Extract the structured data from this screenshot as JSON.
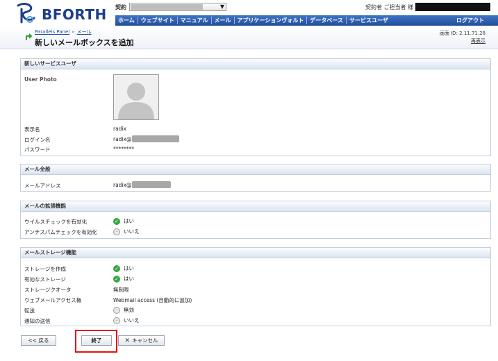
{
  "header": {
    "logo_text": "BFORTH",
    "contract_label": "契約",
    "user_label": "契約者 ご担当者 様",
    "nav": [
      "ホーム",
      "ウェブサイト",
      "マニュアル",
      "メール",
      "アプリケーションヴォルト",
      "データベース",
      "サービスユーザ"
    ],
    "logout": "ログアウト",
    "colors": {
      "nav_bg": "#2f5fb0",
      "logo": "#1d3e8a"
    }
  },
  "title": {
    "breadcrumb_root": "Parallels Panel",
    "breadcrumb_sep": "»",
    "breadcrumb_current": "メール",
    "page_title": "新しいメールボックスを追加",
    "screen_id": "画面 ID: 2.11.71.28",
    "reload": "再表示"
  },
  "sections": {
    "service_user": {
      "title": "新しいサービスユーザ",
      "photo_label": "User Photo",
      "display_name_label": "表示名",
      "display_name": "radix",
      "login_label": "ログイン名",
      "login_value": "radix@",
      "password_label": "パスワード",
      "password_value": "********"
    },
    "mail_general": {
      "title": "メール全般",
      "address_label": "メールアドレス",
      "address_value": "radix@"
    },
    "mail_ext": {
      "title": "メールの拡張機能",
      "virus_label": "ウイルスチェックを有効化",
      "virus_value": "はい",
      "spam_label": "アンチスパムチェックを有効化",
      "spam_value": "いいえ"
    },
    "storage": {
      "title": "メールストレージ機能",
      "create_label": "ストレージを作成",
      "create_value": "はい",
      "enabled_label": "有効なストレージ",
      "enabled_value": "はい",
      "quota_label": "ストレージクオータ",
      "quota_value": "無制限",
      "webmail_label": "ウェブメールアクセス権",
      "webmail_value": "Webmail access (自動的に追加)",
      "forward_label": "転送",
      "forward_value": "無効",
      "notify_label": "通知の送信",
      "notify_value": "いいえ"
    }
  },
  "buttons": {
    "back": "<< 戻る",
    "finish": "終了",
    "cancel": "キャンセル"
  }
}
